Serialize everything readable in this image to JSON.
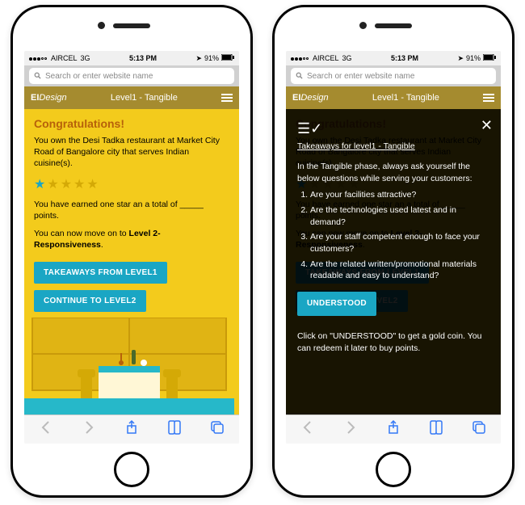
{
  "status": {
    "carrier": "AIRCEL",
    "network": "3G",
    "time": "5:13 PM",
    "battery_pct": "91%"
  },
  "search": {
    "placeholder": "Search or enter website name"
  },
  "appbar": {
    "logo_a": "EI",
    "logo_b": "Design",
    "title": "Level1 - Tangible"
  },
  "left": {
    "heading": "Congratulations!",
    "desc": "You own the Desi Tadka restaurant at Market City Road of Bangalore city that serves Indian cuisine(s).",
    "stars_filled": 1,
    "stars_total": 5,
    "earned": "You have earned one star an a total of _____ points.",
    "moveon_a": "You can now move on to ",
    "moveon_b": "Level 2- Responsiveness",
    "moveon_c": ".",
    "btn1": "TAKEAWAYS FROM LEVEL1",
    "btn2": "CONTINUE TO LEVEL2"
  },
  "right": {
    "title": "Takeaways for level1 - Tangible",
    "intro": "In the Tangible phase, always ask yourself the below questions while serving your customers:",
    "q1": "Are your facilities attractive?",
    "q2": "Are the technologies used latest and in demand?",
    "q3": "Are your staff  competent enough to face your customers?",
    "q4": "Are the related written/promotional materials readable and easy to understand?",
    "understood": "UNDERSTOOD",
    "hint": "Click on \"UNDERSTOOD\" to get a gold coin. You can redeem it later to buy points."
  }
}
